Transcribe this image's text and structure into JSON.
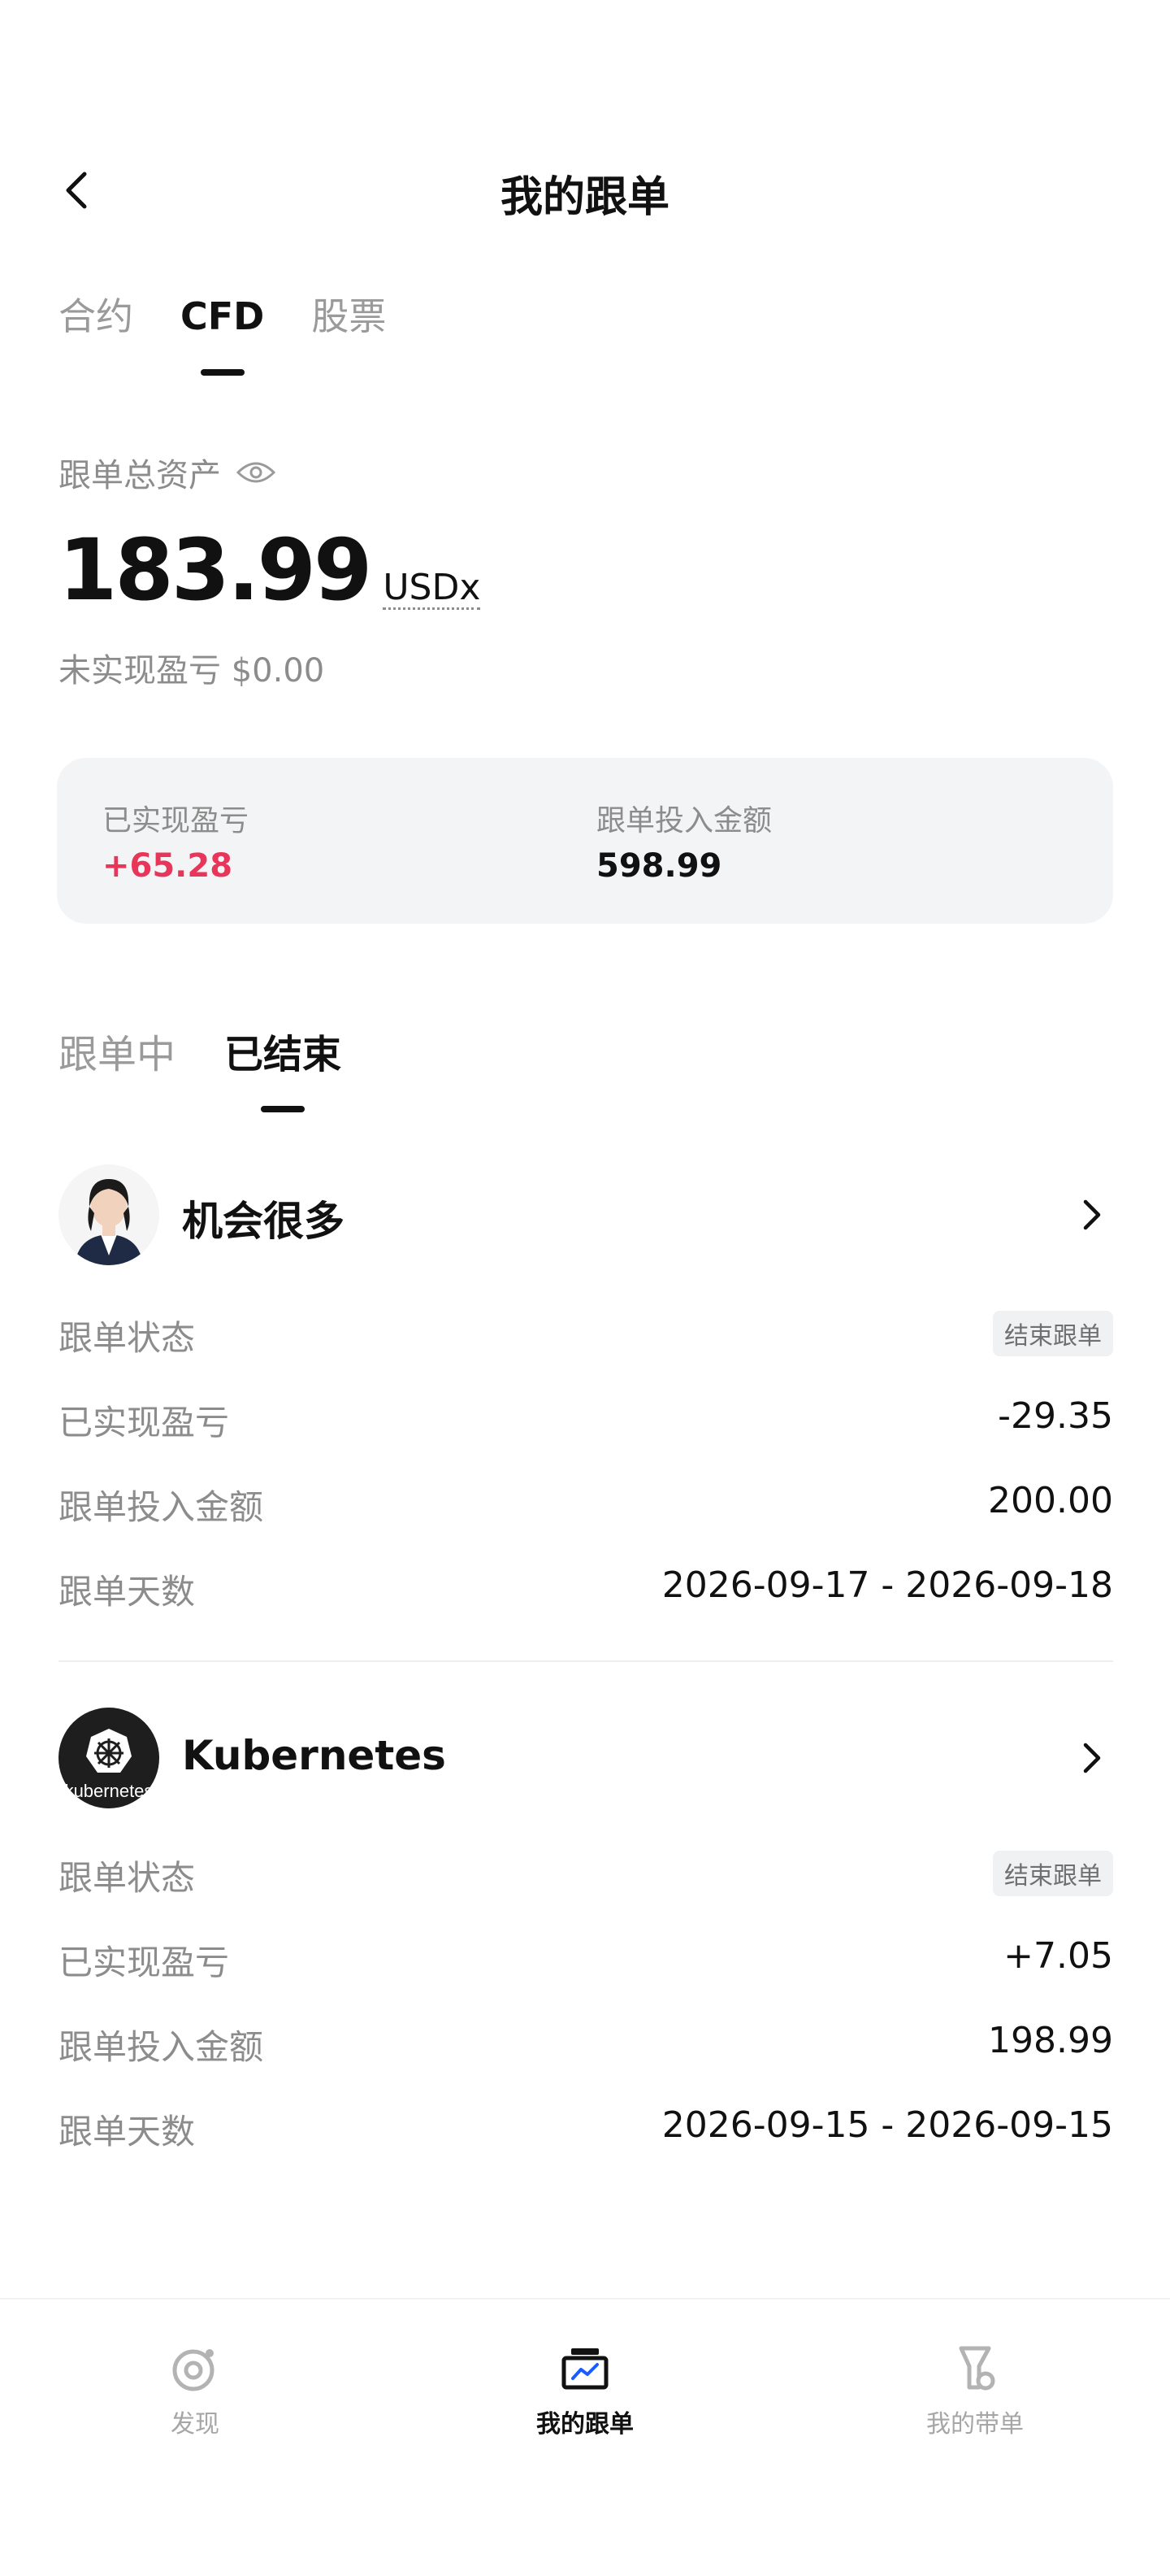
{
  "header": {
    "title": "我的跟单"
  },
  "market_tabs": [
    "合约",
    "CFD",
    "股票"
  ],
  "assets": {
    "label": "跟单总资产",
    "value": "183.99",
    "unit": "USDx",
    "unrealized": "未实现盈亏 $0.00"
  },
  "summary": {
    "realized_label": "已实现盈亏",
    "realized_value": "+65.28",
    "invested_label": "跟单投入金额",
    "invested_value": "598.99"
  },
  "status_tabs": [
    "跟单中",
    "已结束"
  ],
  "traders": [
    {
      "name": "机会很多",
      "rows": [
        {
          "label": "跟单状态",
          "value": "结束跟单",
          "kind": "pill"
        },
        {
          "label": "已实现盈亏",
          "value": "-29.35",
          "kind": "neg"
        },
        {
          "label": "跟单投入金额",
          "value": "200.00",
          "kind": "plain"
        },
        {
          "label": "跟单天数",
          "value": "2026-09-17 - 2026-09-18",
          "kind": "plain"
        }
      ]
    },
    {
      "name": "Kubernetes",
      "avatar_text": "kubernetes",
      "rows": [
        {
          "label": "跟单状态",
          "value": "结束跟单",
          "kind": "pill"
        },
        {
          "label": "已实现盈亏",
          "value": "+7.05",
          "kind": "pos"
        },
        {
          "label": "跟单投入金额",
          "value": "198.99",
          "kind": "plain"
        },
        {
          "label": "跟单天数",
          "value": "2026-09-15 - 2026-09-15",
          "kind": "plain"
        }
      ]
    }
  ],
  "bottom_nav": [
    {
      "label": "发现",
      "icon": "discover-icon"
    },
    {
      "label": "我的跟单",
      "icon": "copy-trade-icon"
    },
    {
      "label": "我的带单",
      "icon": "lead-trade-icon"
    }
  ],
  "colors": {
    "positive": "#e8365b",
    "negative": "#2bbf86",
    "text": "#111111",
    "muted": "#8c8c8c"
  }
}
